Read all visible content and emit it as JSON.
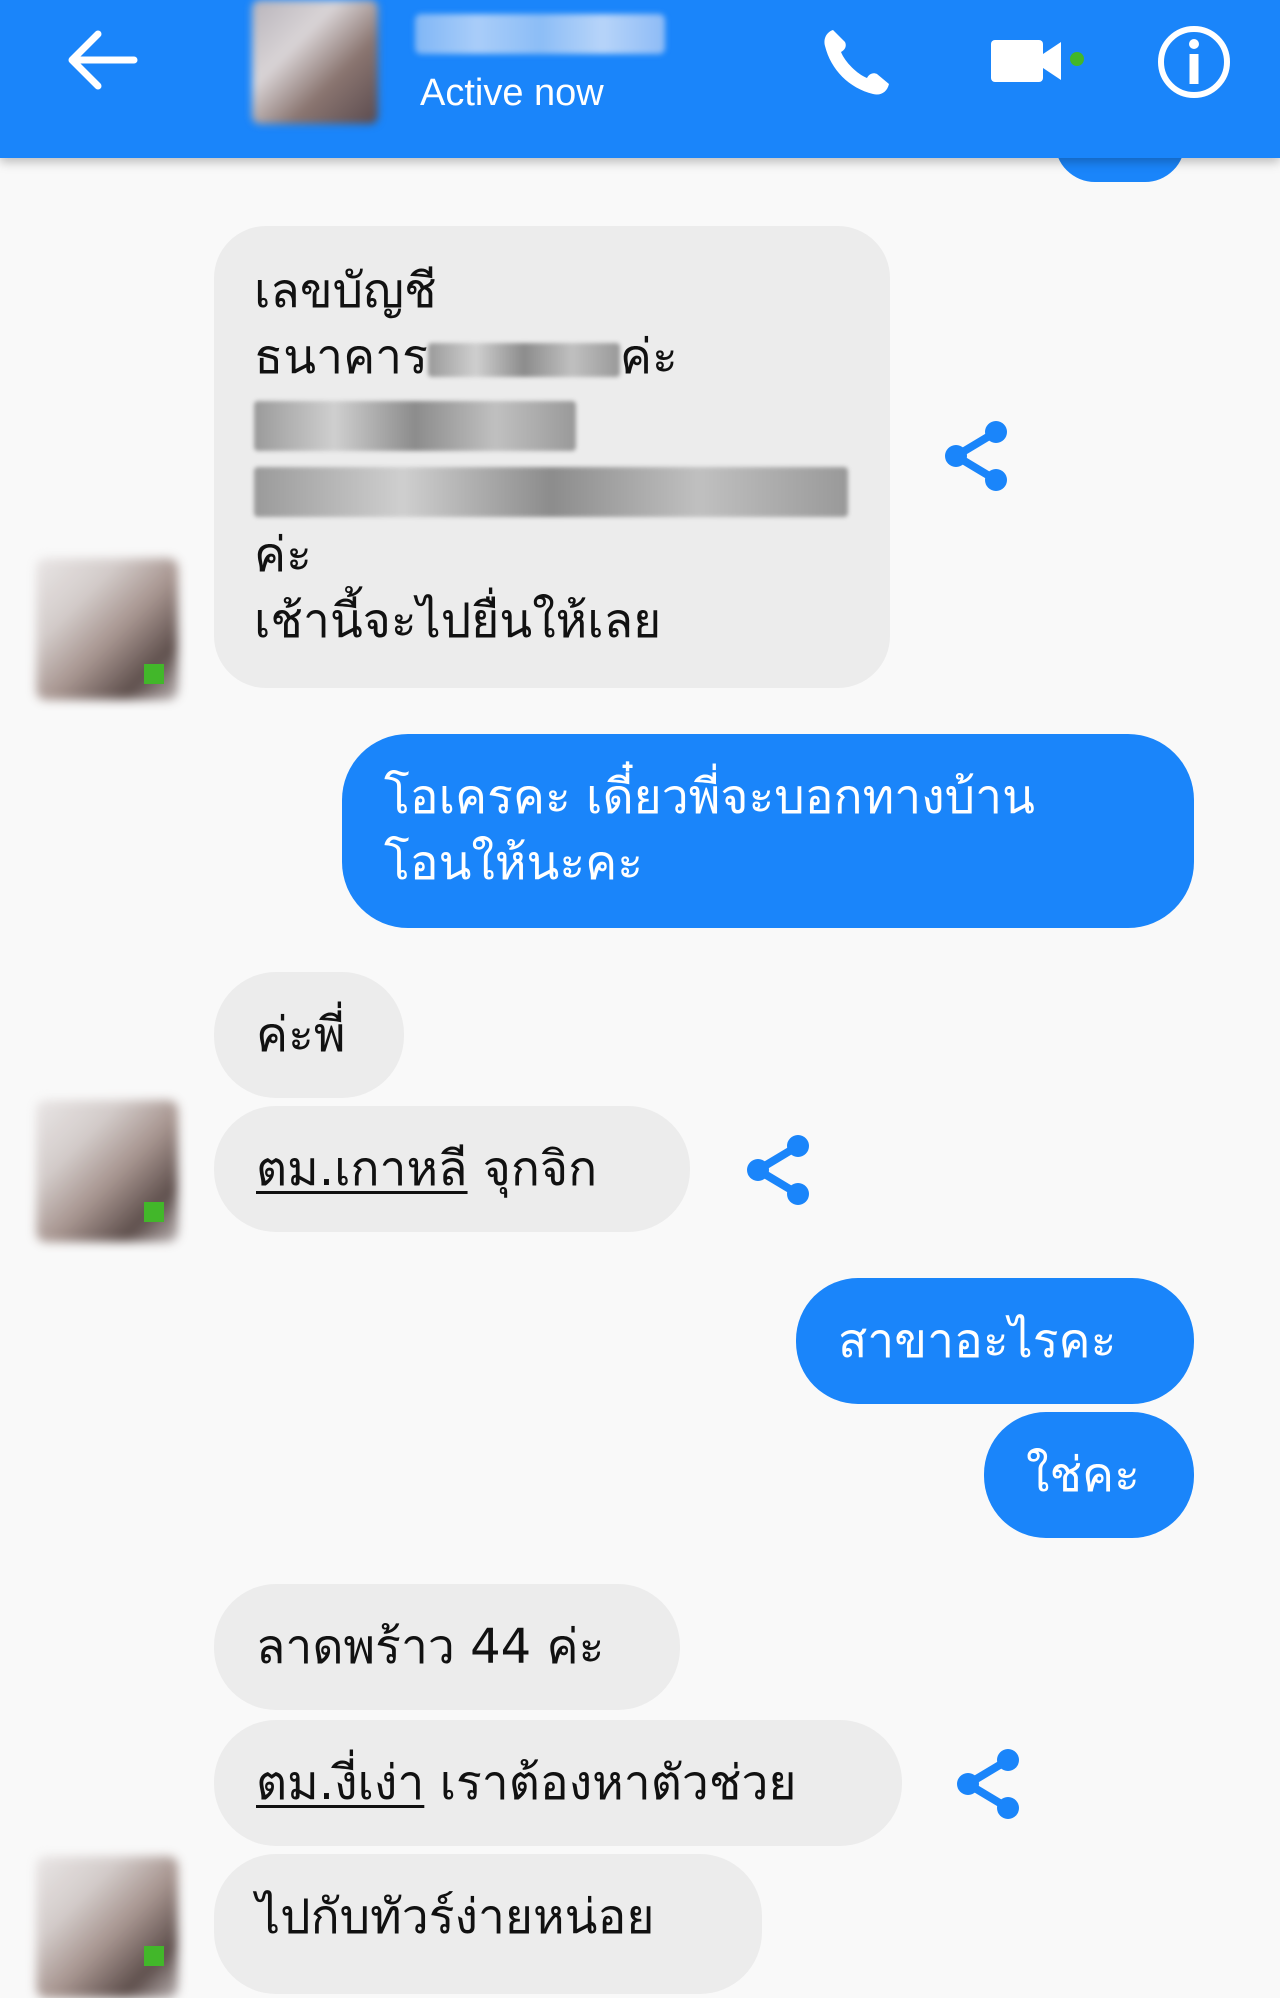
{
  "header": {
    "status": "Active now",
    "colors": {
      "bar": "#1a85fa",
      "online": "#42b72a"
    },
    "icons": [
      "back-arrow-icon",
      "phone-icon",
      "video-icon",
      "info-icon"
    ]
  },
  "messages": {
    "m1": {
      "line1": "เลขบัญชี",
      "line2a": "ธนาคาร",
      "line2b": "ค่ะ",
      "line5": "ค่ะ",
      "line6": "เช้านี้จะไปยื่นให้เลย"
    },
    "m2": {
      "line1": "โอเครคะ  เดี๋ยวพี่จะบอกทางบ้าน",
      "line2": "โอนให้นะคะ"
    },
    "m3": "ค่ะพี่",
    "m4": {
      "link": "ตม.เกาหลี",
      "rest": " จุกจิก"
    },
    "m5": "สาขาอะไรคะ",
    "m6": "ใช่คะ",
    "m7": "ลาดพร้าว 44 ค่ะ",
    "m8": {
      "link": "ตม.งี่เง่า",
      "rest": " เราต้องหาตัวช่วย"
    },
    "m9": "ไปกับทัวร์ง่ายหน่อย"
  }
}
